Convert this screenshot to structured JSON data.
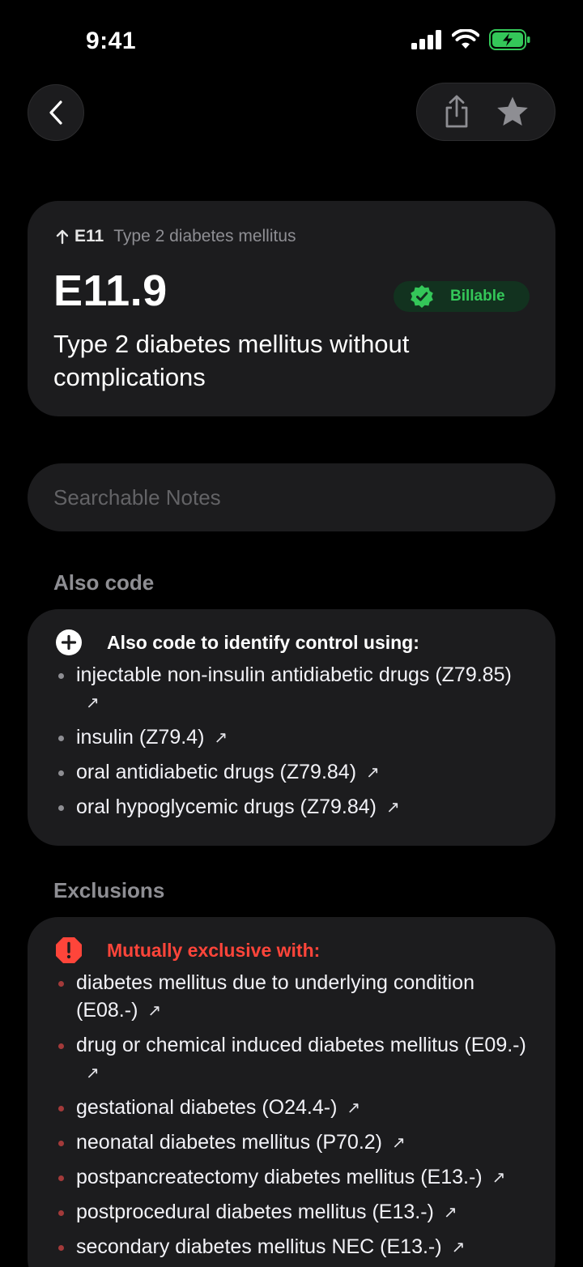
{
  "status": {
    "time": "9:41"
  },
  "code": {
    "parent_code": "E11",
    "parent_description": "Type 2 diabetes mellitus",
    "code": "E11.9",
    "badge": "Billable",
    "description": "Type 2 diabetes mellitus without complications"
  },
  "search": {
    "placeholder": "Searchable Notes"
  },
  "also_code": {
    "title": "Also code",
    "heading": "Also code to identify control using:",
    "items": [
      "injectable non-insulin antidiabetic drugs (Z79.85)",
      "insulin (Z79.4)",
      "oral antidiabetic drugs (Z79.84)",
      "oral hypoglycemic drugs (Z79.84)"
    ]
  },
  "exclusions": {
    "title": "Exclusions",
    "heading": "Mutually exclusive with:",
    "items": [
      "diabetes mellitus due to underlying condition (E08.-)",
      "drug or chemical induced diabetes mellitus (E09.-)",
      "gestational diabetes (O24.4-)",
      "neonatal diabetes mellitus (P70.2)",
      "postpancreatectomy diabetes mellitus (E13.-)",
      "postprocedural diabetes mellitus (E13.-)",
      "secondary diabetes mellitus NEC (E13.-)"
    ]
  },
  "colors": {
    "background": "#000000",
    "card": "#1c1c1e",
    "billable_green": "#34c759",
    "exclusion_red": "#ff453a"
  },
  "icons": [
    "back-chevron-icon",
    "share-icon",
    "star-icon",
    "up-arrow-icon",
    "verified-check-icon",
    "plus-circle-icon",
    "alert-octagon-icon",
    "external-arrow-icon"
  ]
}
